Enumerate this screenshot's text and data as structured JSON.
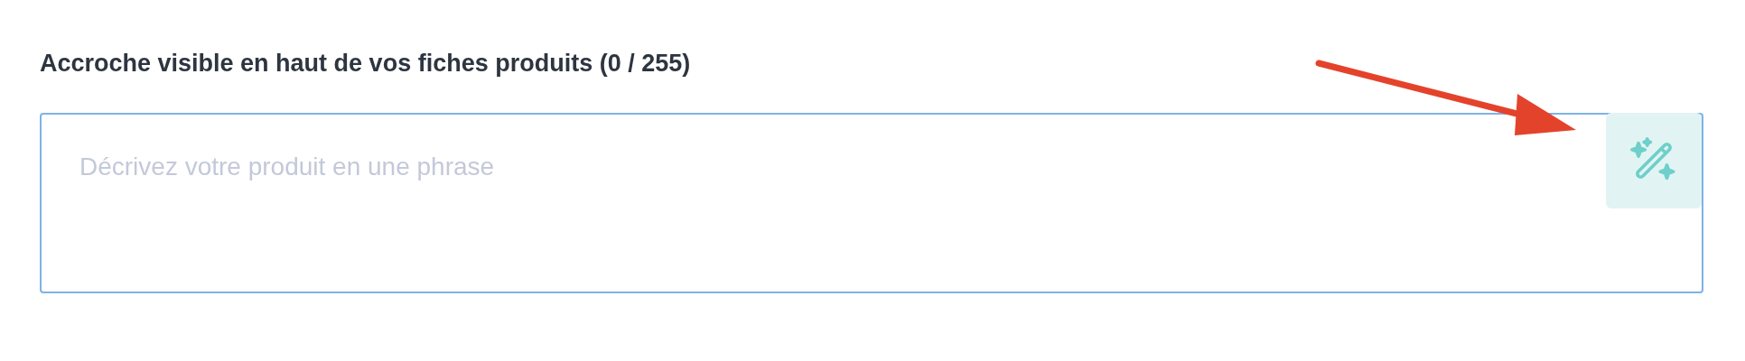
{
  "field": {
    "label": "Accroche visible en haut de vos fiches produits (0 / 255)",
    "placeholder": "Décrivez votre produit en une phrase"
  }
}
